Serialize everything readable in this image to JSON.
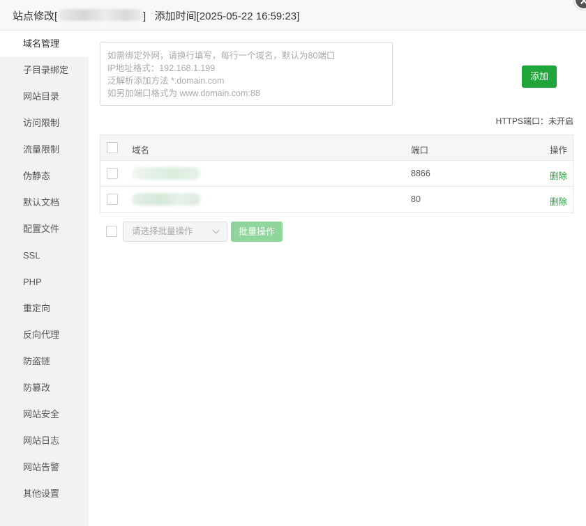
{
  "window": {
    "title_prefix": "站点修改[",
    "title_suffix": "]   添加时间[2025-05-22 16:59:23]"
  },
  "sidebar": {
    "items": [
      {
        "label": "域名管理",
        "active": true
      },
      {
        "label": "子目录绑定"
      },
      {
        "label": "网站目录"
      },
      {
        "label": "访问限制"
      },
      {
        "label": "流量限制"
      },
      {
        "label": "伪静态"
      },
      {
        "label": "默认文档"
      },
      {
        "label": "配置文件"
      },
      {
        "label": "SSL"
      },
      {
        "label": "PHP"
      },
      {
        "label": "重定向"
      },
      {
        "label": "反向代理"
      },
      {
        "label": "防盗链"
      },
      {
        "label": "防篡改"
      },
      {
        "label": "网站安全"
      },
      {
        "label": "网站日志"
      },
      {
        "label": "网站告警"
      },
      {
        "label": "其他设置"
      }
    ]
  },
  "domain_input": {
    "placeholder_lines": [
      "如需绑定外网，请换行填写，每行一个域名，默认为80端口",
      "IP地址格式：192.168.1.199",
      "泛解析添加方法 *.domain.com",
      "如另加端口格式为 www.domain.com:88"
    ],
    "value": ""
  },
  "add_button": {
    "label": "添加"
  },
  "https_status": {
    "text": "HTTPS端口：未开启"
  },
  "table": {
    "headers": {
      "domain": "域名",
      "port": "端口",
      "op": "操作"
    },
    "rows": [
      {
        "port": "8866",
        "action": "删除"
      },
      {
        "port": "80",
        "action": "删除"
      }
    ]
  },
  "batch": {
    "select_placeholder": "请选择批量操作",
    "button_label": "批量操作"
  },
  "colors": {
    "accent": "#20a53a",
    "accent_disabled": "#90d59b"
  }
}
